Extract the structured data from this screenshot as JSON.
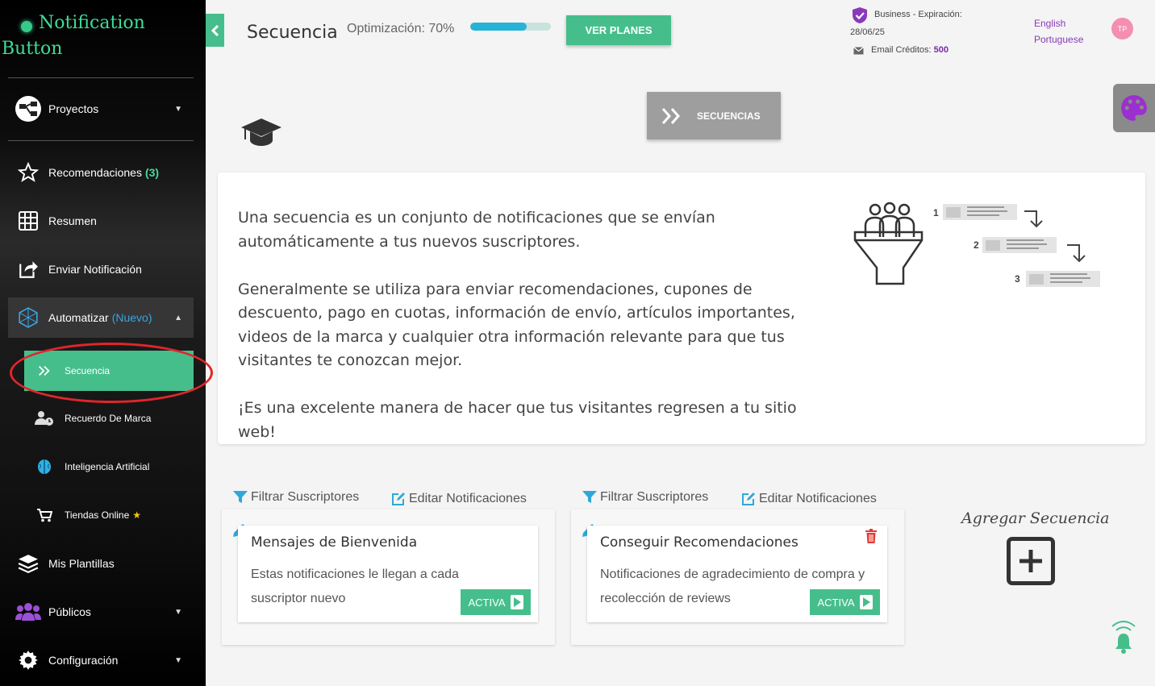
{
  "app": {
    "logo_line1": "Notification",
    "logo_line2": "Button"
  },
  "sidebar": {
    "items": [
      {
        "label": "Proyectos",
        "icon": "project-tree-icon"
      },
      {
        "label": "Recomendaciones",
        "count": "(3)",
        "icon": "star-icon"
      },
      {
        "label": "Resumen",
        "icon": "grid-icon"
      },
      {
        "label": "Enviar Notificación",
        "icon": "share-icon"
      },
      {
        "label": "Automatizar",
        "badge": "(Nuevo)",
        "icon": "automation-icon"
      },
      {
        "label": "Mis Plantillas",
        "icon": "layers-icon"
      },
      {
        "label": "Públicos",
        "icon": "users-icon"
      },
      {
        "label": "Configuración",
        "icon": "gear-icon"
      }
    ],
    "subitems": [
      {
        "label": "Secuencia",
        "icon": "double-chevron-icon"
      },
      {
        "label": "Recuerdo De Marca",
        "icon": "user-clock-icon"
      },
      {
        "label": "Inteligencia Artificial",
        "icon": "brain-icon"
      },
      {
        "label": "Tiendas Online",
        "icon": "cart-icon",
        "star": "★"
      }
    ]
  },
  "header": {
    "title": "Secuencia",
    "optimization_label": "Optimización: 70%",
    "optimization_value": 0.7,
    "plans_button": "VER PLANES",
    "plan_line1": "Business - Expiración:",
    "plan_line2": "28/06/25",
    "credits_label": "Email Créditos:",
    "credits_value": "500",
    "languages": [
      "English",
      "Portuguese"
    ],
    "avatar_initials": "TP"
  },
  "main": {
    "sequences_button": "SECUENCIAS",
    "intro_p1": "Una secuencia es un conjunto de notificaciones que se envían automáticamente a tus nuevos suscriptores.",
    "intro_p2": "Generalmente se utiliza para enviar recomendaciones, cupones de descuento, pago en cuotas, información de envío, artículos importantes, videos de la marca y cualquier otra información relevante para que tus visitantes te conozcan mejor.",
    "intro_p3": "¡Es una excelente manera de hacer que tus visitantes regresen a tu sitio web!",
    "illustration_steps": [
      "1",
      "2",
      "3"
    ],
    "filter_label": "Filtrar Suscriptores",
    "edit_label": "Editar Notificaciones",
    "sequences": [
      {
        "title": "Mensajes de Bienvenida",
        "description": "Estas notificaciones le llegan a cada suscriptor nuevo",
        "status": "ACTIVA"
      },
      {
        "title": "Conseguir Recomendaciones",
        "description": "Notificaciones de agradecimiento de compra y recolección de reviews",
        "status": "ACTIVA"
      }
    ],
    "add_sequence_label": "Agregar Secuencia"
  },
  "colors": {
    "accent": "#46be8c",
    "progress": "#27b3d8",
    "purple": "#8a3ab9",
    "annotation": "#e0262b"
  }
}
